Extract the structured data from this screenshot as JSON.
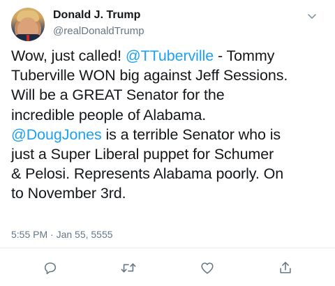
{
  "author": {
    "name": "Donald J. Trump",
    "handle": "@realDonaldTrump",
    "avatar_icon": "profile-photo"
  },
  "tweet": {
    "lines": [
      [
        {
          "text": "Wow, just called! "
        },
        {
          "text": "@TTuberville",
          "mention": true
        },
        {
          "text": " - Tommy"
        }
      ],
      [
        {
          "text": "Tuberville WON big against Jeff Sessions."
        }
      ],
      [
        {
          "text": "Will be a GREAT Senator for the"
        }
      ],
      [
        {
          "text": "incredible people of Alabama."
        }
      ],
      [
        {
          "text": "@DougJones",
          "mention": true
        },
        {
          "text": " is a terrible Senator who is"
        }
      ],
      [
        {
          "text": "just a Super Liberal puppet for Schumer"
        }
      ],
      [
        {
          "text": "& Pelosi. Represents Alabama poorly. On"
        }
      ],
      [
        {
          "text": "to November 3rd."
        }
      ]
    ],
    "timestamp": "5:55 PM · Jan 55, 5555"
  },
  "actions": [
    {
      "name": "reply",
      "icon": "reply-icon"
    },
    {
      "name": "retweet",
      "icon": "retweet-icon"
    },
    {
      "name": "like",
      "icon": "heart-icon"
    },
    {
      "name": "share",
      "icon": "share-icon"
    }
  ],
  "colors": {
    "text": "#14171a",
    "secondary": "#657786",
    "mention": "#1da1f2",
    "divider": "#e6ecf0"
  }
}
